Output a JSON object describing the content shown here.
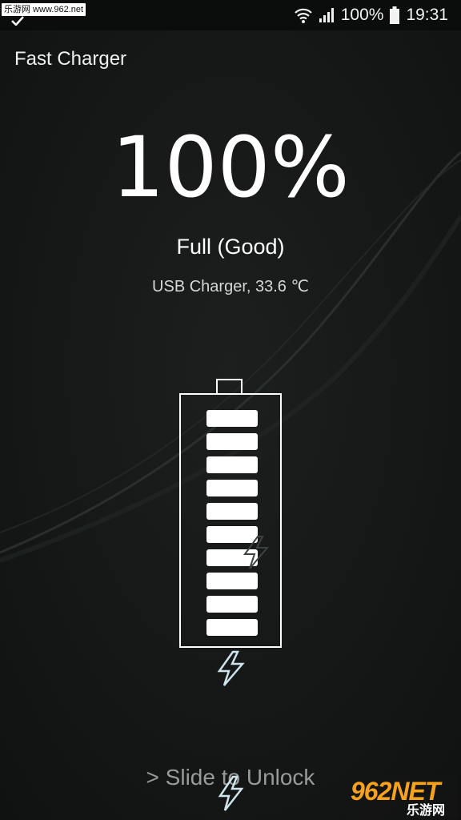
{
  "status_bar": {
    "watermark": "乐游网 www.962.net",
    "battery_percent": "100%",
    "time": "19:31"
  },
  "app": {
    "title": "Fast Charger"
  },
  "battery": {
    "percent_label": "100%",
    "level": 1.0,
    "filled_bars": 10,
    "status": "Full (Good)",
    "details": "USB Charger, 33.6 ℃"
  },
  "actions": {
    "slide_unlock": "> Slide to Unlock"
  },
  "watermark_bottom": {
    "brand": "962NET",
    "site": "乐游网"
  },
  "colors": {
    "background": "#121413",
    "text": "#ffffff",
    "accent_bolt": "#cfe3ec",
    "watermark_orange": "#f7a21b"
  },
  "icons": [
    "check-icon",
    "wifi-icon",
    "signal-icon",
    "battery-status-icon",
    "lightning-bolt-icon"
  ]
}
